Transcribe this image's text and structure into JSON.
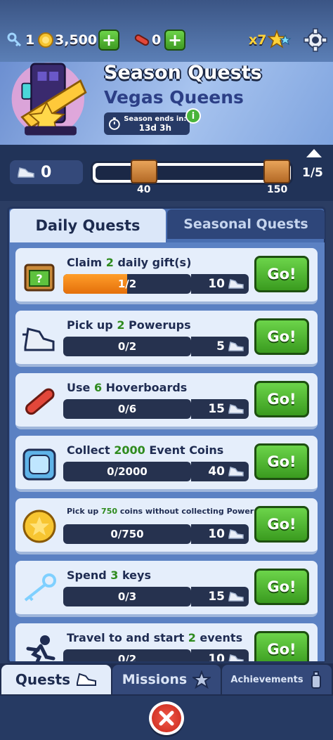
{
  "resources": {
    "keys": "1",
    "coins": "3,500",
    "hoverboards": "0",
    "multiplier": "x7"
  },
  "header": {
    "title": "Season Quests",
    "subtitle": "Vegas Queens",
    "season_ends_label": "Season ends in:",
    "season_ends_value": "13d 3h",
    "info": "i"
  },
  "season_progress": {
    "tokens": "0",
    "milestone_1": "40",
    "milestone_2": "150",
    "page": "1/5"
  },
  "tabs": {
    "daily": "Daily Quests",
    "seasonal": "Seasonal Quests"
  },
  "quests": [
    {
      "pre": "Claim ",
      "num": "2",
      "post": " daily gift(s)",
      "progress": "1/2",
      "progress_fraction": 0.5,
      "reward": "10",
      "go": "Go!",
      "icon": "gift-box-icon"
    },
    {
      "pre": "Pick up ",
      "num": "2",
      "post": " Powerups",
      "progress": "0/2",
      "progress_fraction": 0,
      "reward": "5",
      "go": "Go!",
      "icon": "powerup-sneaker-icon"
    },
    {
      "pre": "Use ",
      "num": "6",
      "post": " Hoverboards",
      "progress": "0/6",
      "progress_fraction": 0,
      "reward": "15",
      "go": "Go!",
      "icon": "hoverboard-icon"
    },
    {
      "pre": "Collect ",
      "num": "2000",
      "post": " Event Coins",
      "progress": "0/2000",
      "progress_fraction": 0,
      "reward": "40",
      "go": "Go!",
      "icon": "event-coin-icon"
    },
    {
      "pre": "Pick up ",
      "num": "750",
      "post": " coins without collecting Powerups",
      "progress": "0/750",
      "progress_fraction": 0,
      "reward": "10",
      "go": "Go!",
      "icon": "gold-coin-icon"
    },
    {
      "pre": "Spend ",
      "num": "3",
      "post": " keys",
      "progress": "0/3",
      "progress_fraction": 0,
      "reward": "15",
      "go": "Go!",
      "icon": "key-icon"
    },
    {
      "pre": "Travel to and start ",
      "num": "2",
      "post": " events",
      "progress": "0/2",
      "progress_fraction": 0,
      "reward": "10",
      "go": "Go!",
      "icon": "runner-icon"
    }
  ],
  "bottom_tabs": {
    "quests": "Quests",
    "missions": "Missions",
    "achievements": "Achievements"
  },
  "colors": {
    "go_green": "#4cb02e",
    "progress_orange": "#f5881a",
    "reward_number_green": "#2e8b1e"
  }
}
